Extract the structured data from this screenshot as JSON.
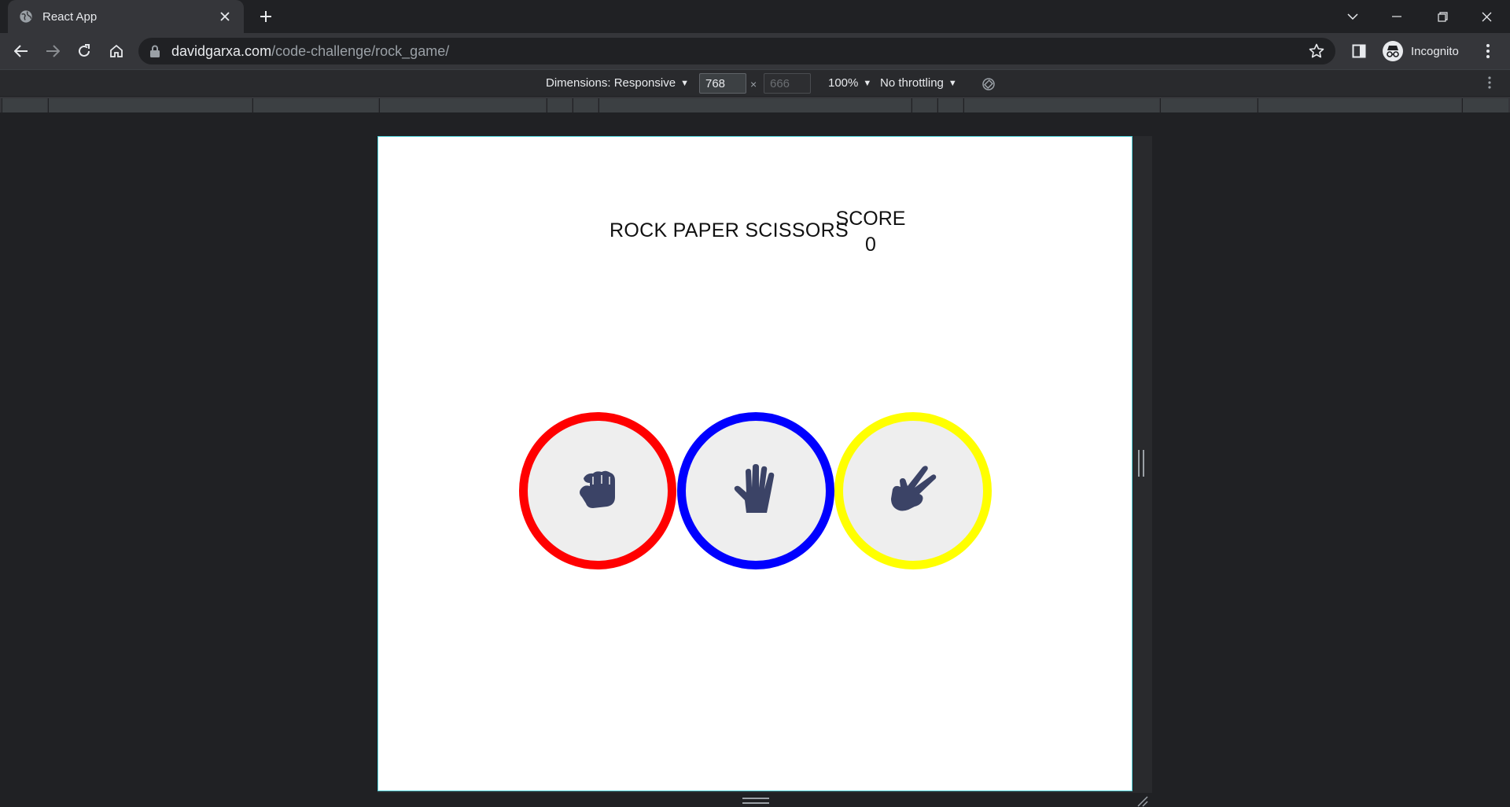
{
  "browser": {
    "tab": {
      "title": "React App",
      "favicon": "globe-icon"
    },
    "url": {
      "host": "davidgarxa.com",
      "path": "/code-challenge/rock_game/"
    },
    "profile_label": "Incognito"
  },
  "devtools": {
    "dimensions_label": "Dimensions: Responsive",
    "width": "768",
    "height": "666",
    "zoom": "100%",
    "throttling": "No throttling"
  },
  "game": {
    "title": "ROCK PAPER SCISSORS",
    "score_label": "SCORE",
    "score_value": "0",
    "choices": [
      {
        "name": "rock",
        "icon": "fist-icon",
        "color": "#ff0000"
      },
      {
        "name": "paper",
        "icon": "open-hand-icon",
        "color": "#0000ff"
      },
      {
        "name": "scissors",
        "icon": "scissors-hand-icon",
        "color": "#ffff00"
      }
    ],
    "icon_color": "#3b4366"
  }
}
